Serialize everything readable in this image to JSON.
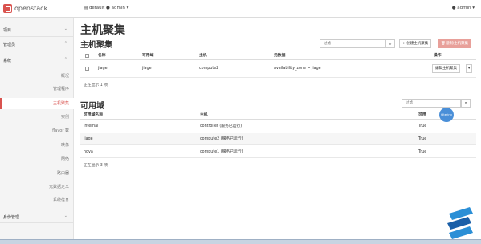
{
  "topbar": {
    "logo_text": "openstack",
    "project_switch": "▤ default ● admin ▾",
    "user_menu": "● admin ▾"
  },
  "sidebar": {
    "sections": [
      {
        "label": "项目",
        "chevron": "⌄"
      },
      {
        "label": "管理员",
        "chevron": "⌃"
      },
      {
        "label": "系统",
        "chevron": "⌃"
      }
    ],
    "items": [
      {
        "label": "概况"
      },
      {
        "label": "管理程序"
      },
      {
        "label": "主机聚集",
        "active": true
      },
      {
        "label": "实例"
      },
      {
        "label": "flavor 数"
      },
      {
        "label": "映像"
      },
      {
        "label": "网络"
      },
      {
        "label": "路由器"
      },
      {
        "label": "元数据定义"
      },
      {
        "label": "系统信息"
      }
    ],
    "identity": {
      "label": "身份管理",
      "chevron": "⌄"
    }
  },
  "main": {
    "page_title": "主机聚集",
    "aggregates": {
      "title": "主机聚集",
      "filter_placeholder": "过滤",
      "create_label": "+ 创建主机聚集",
      "delete_label": "🗑 删除主机聚集",
      "columns": [
        "名称",
        "可用域",
        "主机",
        "元数据",
        "操作"
      ],
      "rows": [
        {
          "name": "jiage",
          "zone": "jiage",
          "hosts": "compute2",
          "metadata": "availability_zone = jiage",
          "action": "编辑主机聚集"
        }
      ],
      "count": "正在显示 1 项"
    },
    "zones": {
      "title": "可用域",
      "filter_placeholder": "过滤",
      "columns": [
        "可用域名称",
        "主机",
        "可用"
      ],
      "rows": [
        {
          "name": "internal",
          "hosts": "controller (服务已运行)",
          "available": "True"
        },
        {
          "name": "jiage",
          "hosts": "compute2 (服务已运行)",
          "available": "True"
        },
        {
          "name": "nova",
          "hosts": "compute1 (服务已运行)",
          "available": "True"
        }
      ],
      "count": "正在显示 3 项"
    },
    "cursor_badge": "filtering"
  },
  "colors": {
    "accent": "#d9534f",
    "badge": "#4a8fd8"
  }
}
